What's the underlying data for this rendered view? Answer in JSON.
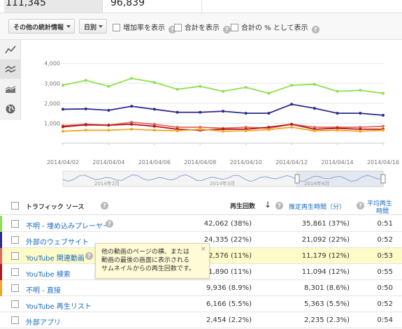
{
  "metrics": {
    "value_1": "111,345",
    "value_2": "96,839"
  },
  "toolbar": {
    "stats_dropdown": "その他の統計情報",
    "period_dropdown": "日別",
    "growth_label": "増加率を表示",
    "total_label": "合計を表示",
    "pct_label": "合計の % として表示",
    "help_glyph": "?"
  },
  "chart_data": {
    "type": "line",
    "x": [
      "2014/04/02",
      "2014/04/03",
      "2014/04/04",
      "2014/04/05",
      "2014/04/06",
      "2014/04/07",
      "2014/04/08",
      "2014/04/09",
      "2014/04/10",
      "2014/04/11",
      "2014/04/12",
      "2014/04/13",
      "2014/04/14",
      "2014/04/15",
      "2014/04/16"
    ],
    "x_tick_labels": [
      "2014/04/02",
      "2014/04/04",
      "2014/04/06",
      "2014/04/08",
      "2014/04/10",
      "2014/04/12",
      "2014/04/14",
      "2014/04/16"
    ],
    "y_tick_labels": [
      "1,000",
      "2,000",
      "3,000",
      "4,000"
    ],
    "ylim": [
      0,
      4200
    ],
    "grid": true,
    "series": [
      {
        "color": "#8ee04e",
        "values": [
          2900,
          3150,
          2850,
          3250,
          3050,
          2700,
          2850,
          2600,
          2800,
          2500,
          2900,
          2950,
          2600,
          2650,
          2500
        ]
      },
      {
        "color": "#2b2b8c",
        "values": [
          1700,
          1720,
          1650,
          1850,
          1700,
          1550,
          1550,
          1600,
          1500,
          1500,
          1950,
          1750,
          1500,
          1500,
          1400
        ]
      },
      {
        "color": "#e06a5a",
        "values": [
          880,
          950,
          900,
          1050,
          950,
          800,
          800,
          750,
          800,
          750,
          950,
          800,
          800,
          800,
          850
        ]
      },
      {
        "color": "#b4161d",
        "values": [
          820,
          920,
          900,
          950,
          850,
          700,
          650,
          700,
          700,
          800,
          950,
          700,
          750,
          700,
          700
        ]
      },
      {
        "color": "#f5a623",
        "values": [
          600,
          650,
          650,
          700,
          650,
          620,
          700,
          600,
          620,
          680,
          800,
          620,
          650,
          600,
          650
        ]
      }
    ]
  },
  "navigator": {
    "labels": [
      "2014年2月",
      "2014年3月",
      "2014年4月"
    ]
  },
  "table": {
    "headers": {
      "source": "トラフィック ソース",
      "views": "再生回数",
      "watch": "推定再生時間（分）",
      "avg_line1": "平均再生",
      "avg_line2": "時間"
    },
    "rows": [
      {
        "source": "不明 - 埋め込みプレーヤー",
        "views": "42,062 (38%)",
        "watch": "35,861 (37%)",
        "avg": "0:51",
        "color": "#8ee04e"
      },
      {
        "source": "外部のウェブサイト",
        "views": "24,335 (22%)",
        "watch": "21,092 (22%)",
        "avg": "0:52",
        "color": "#2b2b8c"
      },
      {
        "source": "YouTube 関連動画",
        "views": "12,576 (11%)",
        "watch": "11,179 (12%)",
        "avg": "0:53",
        "color": "#e06a5a"
      },
      {
        "source": "YouTube 検索",
        "views": "11,890 (11%)",
        "watch": "11,094 (12%)",
        "avg": "0:55",
        "color": "#b4161d"
      },
      {
        "source": "不明 - 直接",
        "views": "9,936 (8.9%)",
        "watch": "8,301 (8.6%)",
        "avg": "0:50",
        "color": "#f5a623"
      },
      {
        "source": "YouTube 再生リスト",
        "views": "6,166 (5.5%)",
        "watch": "5,363 (5.5%)",
        "avg": "0:52",
        "color": ""
      },
      {
        "source": "外部アプリ",
        "views": "2,454 (2.2%)",
        "watch": "2,235 (2.3%)",
        "avg": "0:54",
        "color": ""
      }
    ]
  },
  "tooltip": {
    "text": "他の動画のページの横、または動画の最後の画面に表示されるサムネイルからの再生回数です。",
    "close_glyph": "×"
  }
}
